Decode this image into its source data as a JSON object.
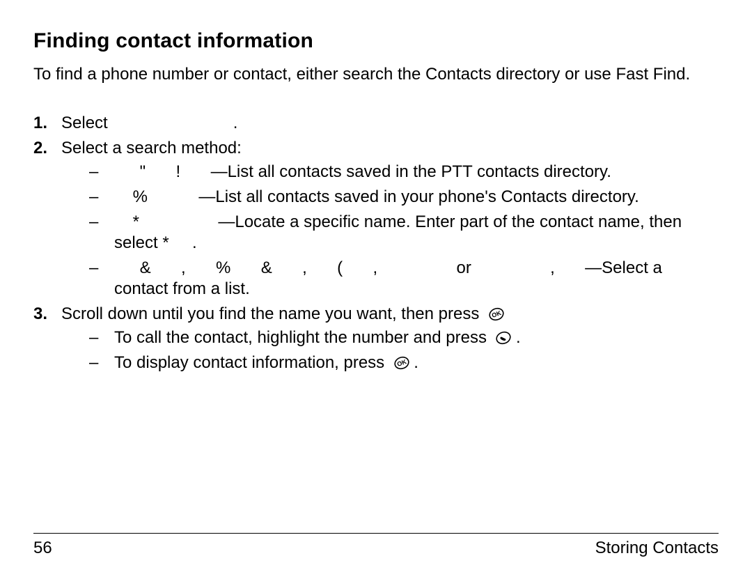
{
  "title": "Finding contact information",
  "intro": "To find a phone number or contact, either search the Contacts directory or use Fast Find.",
  "steps": {
    "s1_num": "1.",
    "s1_a": "Select",
    "s1_b": ".",
    "s2_num": "2.",
    "s2": "Select a search method:",
    "s2a_sym1": "\"",
    "s2a_sym2": "!",
    "s2a": "—List all contacts saved in the PTT contacts directory.",
    "s2b_sym": "%",
    "s2b": "—List all contacts saved in your phone's Contacts directory.",
    "s2c_sym": "*",
    "s2c_a": "—Locate a specific name. Enter part of the contact name, then select *",
    "s2c_b": ".",
    "s2d_sym1": "&",
    "s2d_sym2": ",",
    "s2d_sym3": "%",
    "s2d_sym4": "&",
    "s2d_sym5": ",",
    "s2d_sym6": "(",
    "s2d_sym7": ",",
    "s2d_or": "or",
    "s2d_sym8": ",",
    "s2d_tail": "—Select a contact from a list.",
    "s3_num": "3.",
    "s3": "Scroll down until you find the name you want, then press",
    "s3a_a": "To call the contact, highlight the number and press",
    "s3a_b": ".",
    "s3b_a": "To display contact information, press",
    "s3b_b": "."
  },
  "footer": {
    "page": "56",
    "section": "Storing Contacts"
  },
  "icons": {
    "ok": "ok-icon",
    "call": "call-icon"
  }
}
